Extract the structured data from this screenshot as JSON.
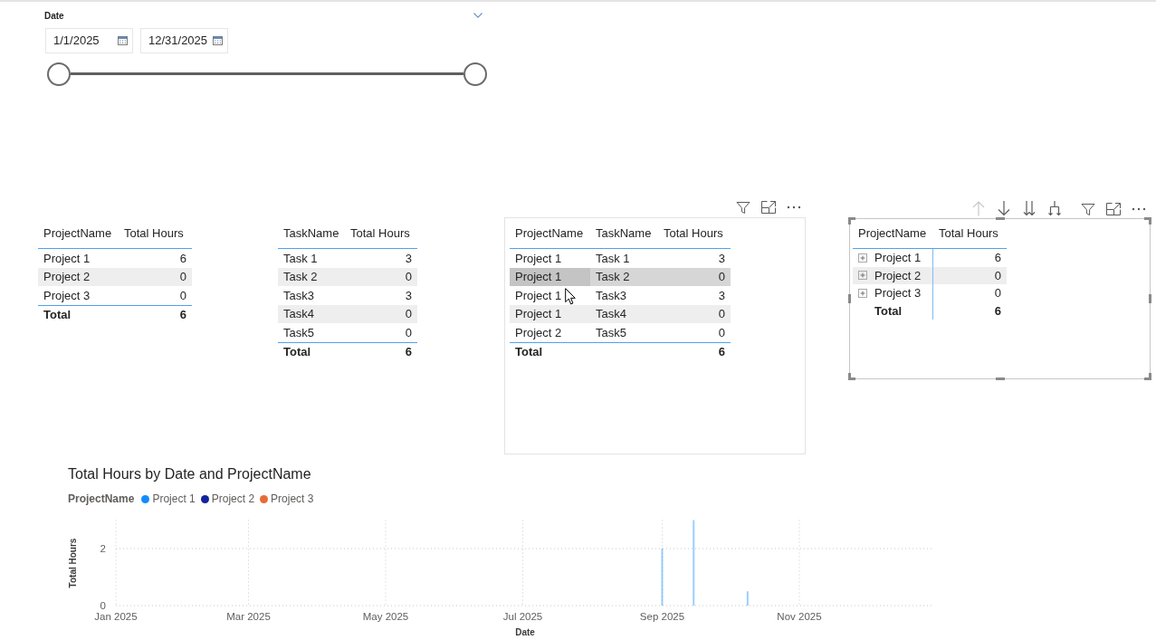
{
  "date_slicer": {
    "title": "Date",
    "start": {
      "value": "1/1/2025"
    },
    "end": {
      "value": "12/31/2025"
    },
    "handles": [
      {
        "level": 0
      },
      {
        "level": 1
      }
    ]
  },
  "visuals": [
    {
      "kind": "table",
      "selected": false,
      "hovered": false,
      "columns": [
        "ProjectName",
        "Total Hours"
      ],
      "rows": [
        {
          "cells": [
            "Project 1",
            "6"
          ]
        },
        {
          "cells": [
            "Project 2",
            "0"
          ]
        },
        {
          "cells": [
            "Project 3",
            "0"
          ]
        }
      ],
      "total": {
        "label": "Total",
        "value": "6"
      }
    },
    {
      "kind": "table",
      "selected": false,
      "hovered": false,
      "columns": [
        "TaskName",
        "Total Hours"
      ],
      "rows": [
        {
          "cells": [
            "Task 1",
            "3"
          ]
        },
        {
          "cells": [
            "Task 2",
            "0"
          ]
        },
        {
          "cells": [
            "Task3",
            "3"
          ]
        },
        {
          "cells": [
            "Task4",
            "0"
          ]
        },
        {
          "cells": [
            "Task5",
            "0"
          ]
        }
      ],
      "total": {
        "label": "Total",
        "value": "6"
      }
    },
    {
      "kind": "table",
      "selected": false,
      "hovered": true,
      "columns": [
        "ProjectName",
        "TaskName",
        "Total Hours"
      ],
      "rows": [
        {
          "cells": [
            "Project 1",
            "Task 1",
            "3"
          ],
          "highlighted": false
        },
        {
          "cells": [
            "Project 1",
            "Task 2",
            "0"
          ],
          "highlighted": true
        },
        {
          "cells": [
            "Project 1",
            "Task3",
            "3"
          ],
          "highlighted": false
        },
        {
          "cells": [
            "Project 1",
            "Task4",
            "0"
          ],
          "highlighted": false
        },
        {
          "cells": [
            "Project 2",
            "Task5",
            "0"
          ],
          "highlighted": false
        }
      ],
      "total": {
        "label": "Total",
        "value": "6"
      }
    },
    {
      "kind": "matrix",
      "selected": true,
      "drill_up_disabled": true,
      "columns": [
        "ProjectName",
        "Total Hours"
      ],
      "rows": [
        {
          "label": "Project 1",
          "value": "6",
          "expanded": false
        },
        {
          "label": "Project 2",
          "value": "0",
          "expanded": false
        },
        {
          "label": "Project 3",
          "value": "0",
          "expanded": false
        }
      ],
      "total": {
        "label": "Total",
        "value": "6"
      }
    }
  ],
  "chart": {
    "legend_title": "ProjectName",
    "chart_data": {
      "type": "bar",
      "title": "Total Hours by Date and ProjectName",
      "xlabel": "Date",
      "ylabel": "Total Hours",
      "x": [
        "2025-09-01",
        "2025-09-15",
        "2025-10-09"
      ],
      "series": [
        {
          "name": "Project 1",
          "color": "#118dff",
          "values": [
            2,
            3,
            0.5
          ]
        },
        {
          "name": "Project 2",
          "color": "#12239e",
          "values": [
            0,
            0,
            0
          ]
        },
        {
          "name": "Project 3",
          "color": "#e66c37",
          "values": [
            0,
            0,
            0
          ]
        }
      ],
      "xlim": [
        "2025-01-01",
        "2025-12-31"
      ],
      "ylim": [
        0,
        3
      ],
      "xticks": [
        {
          "value": "2025-01-01",
          "label": "Jan 2025"
        },
        {
          "value": "2025-03-01",
          "label": "Mar 2025"
        },
        {
          "value": "2025-05-01",
          "label": "May 2025"
        },
        {
          "value": "2025-07-01",
          "label": "Jul 2025"
        },
        {
          "value": "2025-09-01",
          "label": "Sep 2025"
        },
        {
          "value": "2025-11-01",
          "label": "Nov 2025"
        }
      ],
      "yticks": [
        0,
        2
      ],
      "grid": true,
      "stacked": true
    }
  }
}
